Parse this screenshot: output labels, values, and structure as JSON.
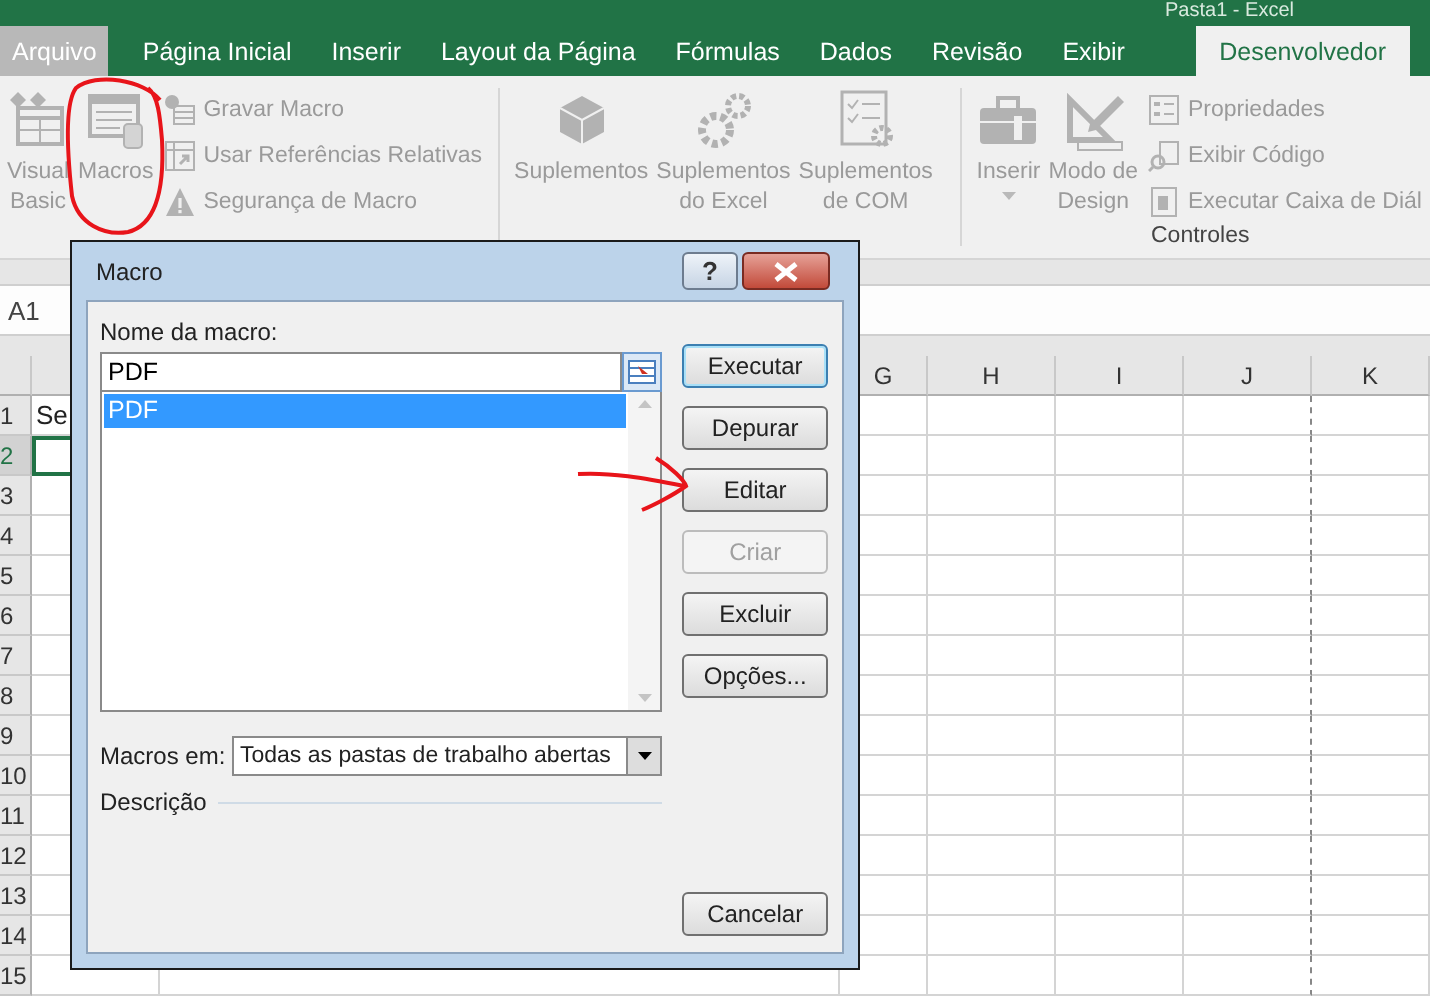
{
  "window": {
    "title": "Pasta1 - Excel"
  },
  "tabs": [
    {
      "label": "Arquivo",
      "kind": "file",
      "selected": false
    },
    {
      "label": "Página Inicial",
      "kind": "tab",
      "selected": false
    },
    {
      "label": "Inserir",
      "kind": "tab",
      "selected": false
    },
    {
      "label": "Layout da Página",
      "kind": "tab",
      "selected": false
    },
    {
      "label": "Fórmulas",
      "kind": "tab",
      "selected": false
    },
    {
      "label": "Dados",
      "kind": "tab",
      "selected": false
    },
    {
      "label": "Revisão",
      "kind": "tab",
      "selected": false
    },
    {
      "label": "Exibir",
      "kind": "tab",
      "selected": false
    },
    {
      "label": "Desenvolvedor",
      "kind": "tab",
      "selected": true
    }
  ],
  "ribbon": {
    "groups": [
      {
        "large": [
          {
            "lines": [
              "Visual",
              "Basic"
            ],
            "kind": "vb",
            "disabled": true,
            "dropdown": false
          },
          {
            "lines": [
              "Macros"
            ],
            "kind": "macros",
            "disabled": true,
            "dropdown": false
          }
        ],
        "small": [
          {
            "label": "Gravar Macro",
            "kind": "record",
            "disabled": true
          },
          {
            "label": "Usar Referências Relativas",
            "kind": "relative",
            "disabled": true
          },
          {
            "label": "Segurança de Macro",
            "kind": "security",
            "disabled": true
          }
        ]
      },
      {
        "large": [
          {
            "lines": [
              "Suplementos"
            ],
            "kind": "addins",
            "disabled": true,
            "dropdown": false
          },
          {
            "lines": [
              "Suplementos",
              "do Excel"
            ],
            "kind": "excel-addins",
            "disabled": true,
            "dropdown": false
          },
          {
            "lines": [
              "Suplementos",
              "de COM"
            ],
            "kind": "com-addins",
            "disabled": true,
            "dropdown": false
          }
        ]
      },
      {
        "label": "Controles",
        "large": [
          {
            "lines": [
              "Inserir"
            ],
            "kind": "insert",
            "disabled": true,
            "dropdown": true
          },
          {
            "lines": [
              "Modo de",
              "Design"
            ],
            "kind": "design",
            "disabled": true,
            "dropdown": false
          }
        ],
        "small": [
          {
            "label": "Propriedades",
            "kind": "properties",
            "disabled": true
          },
          {
            "label": "Exibir Código",
            "kind": "view-code",
            "disabled": true
          },
          {
            "label": "Executar Caixa de Diál",
            "kind": "dialog",
            "disabled": true
          }
        ]
      }
    ]
  },
  "name_box": "A1",
  "sheet": {
    "columns": [
      "G",
      "H",
      "I",
      "J",
      "K"
    ],
    "rows": [
      {
        "label": "1",
        "selected": false,
        "cell": "Se"
      },
      {
        "label": "2",
        "selected": true
      },
      {
        "label": "3",
        "selected": false
      },
      {
        "label": "4",
        "selected": false
      },
      {
        "label": "5",
        "selected": false
      },
      {
        "label": "6",
        "selected": false
      },
      {
        "label": "7",
        "selected": false
      },
      {
        "label": "8",
        "selected": false
      },
      {
        "label": "9",
        "selected": false
      },
      {
        "label": "10",
        "selected": false
      },
      {
        "label": "11",
        "selected": false
      },
      {
        "label": "12",
        "selected": false
      },
      {
        "label": "13",
        "selected": false
      },
      {
        "label": "14",
        "selected": false
      },
      {
        "label": "15",
        "selected": false
      }
    ]
  },
  "dialog": {
    "title": "Macro",
    "help_button": "?",
    "name_label": "Nome da macro:",
    "name_value": "PDF",
    "macros": [
      {
        "label": "PDF",
        "selected": true
      }
    ],
    "buttons": [
      {
        "label": "Executar",
        "default": true,
        "disabled": false
      },
      {
        "label": "Depurar",
        "default": false,
        "disabled": false
      },
      {
        "label": "Editar",
        "default": false,
        "disabled": false
      },
      {
        "label": "Criar",
        "default": false,
        "disabled": true
      },
      {
        "label": "Excluir",
        "default": false,
        "disabled": false
      },
      {
        "label": "Opções...",
        "default": false,
        "disabled": false
      }
    ],
    "location_label": "Macros em:",
    "location_value": "Todas as pastas de trabalho abertas",
    "description_label": "Descrição",
    "cancel_button": "Cancelar"
  }
}
